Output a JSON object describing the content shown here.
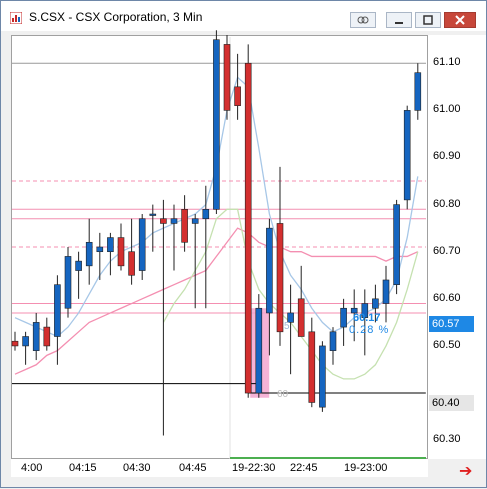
{
  "window": {
    "title": "S.CSX - CSX Corporation, 3 Min",
    "buttons": [
      "link-icon",
      "minimize-icon",
      "maximize-icon",
      "close-icon"
    ]
  },
  "price_axis": {
    "ticks": [
      "61.10",
      "61.00",
      "60.90",
      "60.80",
      "60.70",
      "60.60",
      "60.50",
      "60.30"
    ],
    "markers": [
      {
        "label": "60.57",
        "value": 60.57,
        "color": "#1e88e5"
      },
      {
        "label": "60.40",
        "value": 60.4,
        "color": "#e6e6e6"
      }
    ]
  },
  "time_axis": {
    "ticks": [
      "4:00",
      "04:15",
      "04:30",
      "04:45",
      "19-22:30",
      "22:45",
      "19-23:00"
    ]
  },
  "overlays": {
    "last_price_label": "60.17",
    "pct_change_label": "0.28 %",
    "small_labels": [
      "60",
      "5"
    ]
  },
  "colors": {
    "up": "#1565c0",
    "down": "#d32f2f",
    "ma_blue": "#a7c7e7",
    "ma_green": "#c5e1b0",
    "pink": "#f48fb1"
  },
  "chart_data": {
    "type": "candlestick",
    "title": "S.CSX - CSX Corporation, 3 Min",
    "ylim": [
      60.26,
      61.16
    ],
    "candles": [
      {
        "o": 60.51,
        "h": 60.53,
        "l": 60.49,
        "c": 60.5
      },
      {
        "o": 60.5,
        "h": 60.53,
        "l": 60.46,
        "c": 60.52
      },
      {
        "o": 60.49,
        "h": 60.57,
        "l": 60.47,
        "c": 60.55
      },
      {
        "o": 60.54,
        "h": 60.56,
        "l": 60.49,
        "c": 60.5
      },
      {
        "o": 60.52,
        "h": 60.65,
        "l": 60.46,
        "c": 60.63
      },
      {
        "o": 60.58,
        "h": 60.71,
        "l": 60.56,
        "c": 60.69
      },
      {
        "o": 60.66,
        "h": 60.7,
        "l": 60.6,
        "c": 60.68
      },
      {
        "o": 60.67,
        "h": 60.77,
        "l": 60.63,
        "c": 60.72
      },
      {
        "o": 60.7,
        "h": 60.74,
        "l": 60.64,
        "c": 60.71
      },
      {
        "o": 60.7,
        "h": 60.74,
        "l": 60.65,
        "c": 60.73
      },
      {
        "o": 60.73,
        "h": 60.76,
        "l": 60.66,
        "c": 60.67
      },
      {
        "o": 60.7,
        "h": 60.77,
        "l": 60.63,
        "c": 60.65
      },
      {
        "o": 60.66,
        "h": 60.78,
        "l": 60.64,
        "c": 60.77
      },
      {
        "o": 60.78,
        "h": 60.8,
        "l": 60.7,
        "c": 60.78
      },
      {
        "o": 60.77,
        "h": 60.81,
        "l": 60.31,
        "c": 60.76
      },
      {
        "o": 60.76,
        "h": 60.8,
        "l": 60.66,
        "c": 60.77
      },
      {
        "o": 60.79,
        "h": 60.82,
        "l": 60.7,
        "c": 60.72
      },
      {
        "o": 60.76,
        "h": 60.78,
        "l": 60.58,
        "c": 60.77
      },
      {
        "o": 60.77,
        "h": 60.84,
        "l": 60.58,
        "c": 60.79
      },
      {
        "o": 60.79,
        "h": 61.17,
        "l": 60.78,
        "c": 61.15
      },
      {
        "o": 61.14,
        "h": 61.16,
        "l": 60.98,
        "c": 61.0
      },
      {
        "o": 61.05,
        "h": 61.12,
        "l": 60.98,
        "c": 61.01
      },
      {
        "o": 61.1,
        "h": 61.14,
        "l": 60.39,
        "c": 60.4
      },
      {
        "o": 60.4,
        "h": 60.61,
        "l": 60.39,
        "c": 60.58
      },
      {
        "o": 60.57,
        "h": 60.77,
        "l": 60.48,
        "c": 60.75
      },
      {
        "o": 60.76,
        "h": 60.88,
        "l": 60.5,
        "c": 60.53
      },
      {
        "o": 60.55,
        "h": 60.63,
        "l": 60.44,
        "c": 60.57
      },
      {
        "o": 60.6,
        "h": 60.67,
        "l": 60.52,
        "c": 60.52
      },
      {
        "o": 60.53,
        "h": 60.56,
        "l": 60.37,
        "c": 60.38
      },
      {
        "o": 60.37,
        "h": 60.51,
        "l": 60.36,
        "c": 60.5
      },
      {
        "o": 60.49,
        "h": 60.54,
        "l": 60.46,
        "c": 60.53
      },
      {
        "o": 60.54,
        "h": 60.6,
        "l": 60.5,
        "c": 60.58
      },
      {
        "o": 60.57,
        "h": 60.62,
        "l": 60.51,
        "c": 60.58
      },
      {
        "o": 60.56,
        "h": 60.62,
        "l": 60.48,
        "c": 60.59
      },
      {
        "o": 60.58,
        "h": 60.63,
        "l": 60.55,
        "c": 60.6
      },
      {
        "o": 60.59,
        "h": 60.67,
        "l": 60.55,
        "c": 60.64
      },
      {
        "o": 60.63,
        "h": 60.81,
        "l": 60.61,
        "c": 60.8
      },
      {
        "o": 60.81,
        "h": 61.01,
        "l": 60.79,
        "c": 61.0
      },
      {
        "o": 61.0,
        "h": 61.1,
        "l": 60.98,
        "c": 61.08
      }
    ],
    "lines": {
      "ma_blue": [
        60.56,
        60.55,
        60.54,
        60.53,
        60.52,
        60.54,
        60.57,
        60.61,
        60.65,
        60.68,
        60.7,
        60.71,
        60.72,
        60.74,
        60.75,
        60.76,
        60.77,
        60.78,
        60.8,
        60.88,
        61.0,
        61.07,
        61.05,
        60.92,
        60.78,
        60.7,
        60.65,
        60.62,
        60.58,
        60.55,
        60.53,
        60.54,
        60.56,
        60.57,
        60.58,
        60.6,
        60.64,
        60.73,
        60.86
      ],
      "ma_green": [
        null,
        null,
        null,
        null,
        null,
        null,
        null,
        null,
        null,
        null,
        null,
        null,
        null,
        null,
        60.55,
        60.59,
        60.62,
        60.66,
        60.7,
        60.77,
        60.79,
        60.79,
        60.68,
        60.62,
        60.59,
        60.57,
        60.55,
        60.52,
        60.49,
        60.46,
        60.44,
        60.43,
        60.43,
        60.44,
        60.46,
        60.5,
        60.55,
        60.62,
        60.7
      ],
      "pink_line": [
        60.44,
        60.45,
        60.46,
        60.48,
        60.49,
        60.51,
        60.53,
        60.55,
        60.56,
        60.57,
        60.58,
        60.59,
        60.6,
        60.61,
        60.62,
        60.63,
        60.64,
        60.65,
        60.66,
        60.69,
        60.72,
        60.75,
        60.74,
        60.72,
        60.71,
        60.71,
        60.7,
        60.7,
        60.69,
        60.69,
        60.69,
        60.69,
        60.69,
        60.69,
        60.69,
        60.68,
        60.69,
        60.69,
        60.7
      ]
    },
    "horizontal_levels": [
      {
        "y": 61.1,
        "style": "gray"
      },
      {
        "y": 60.85,
        "style": "pink-dashed"
      },
      {
        "y": 60.79,
        "style": "pink"
      },
      {
        "y": 60.77,
        "style": "pink"
      },
      {
        "y": 60.71,
        "style": "pink-dashed"
      },
      {
        "y": 60.59,
        "style": "pink"
      },
      {
        "y": 60.57,
        "style": "pink"
      }
    ],
    "step_line": [
      {
        "from": 0,
        "to": 22,
        "y": 60.42,
        "color": "#000"
      },
      {
        "from": 22,
        "to": 38,
        "y": 60.4,
        "color": "#000"
      }
    ]
  }
}
